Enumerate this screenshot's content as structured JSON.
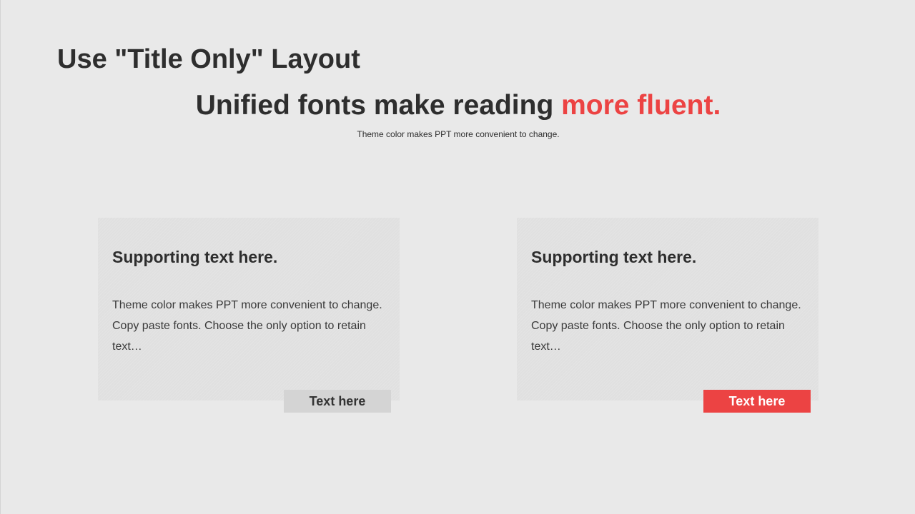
{
  "slide": {
    "layout_title": "Use \"Title Only\" Layout",
    "headline": {
      "main": "Unified fonts make reading ",
      "accent": "more fluent."
    },
    "subline": "Theme color makes PPT more convenient to change."
  },
  "cards": [
    {
      "heading": "Supporting text here.",
      "body": "Theme color makes PPT more convenient to change. Copy paste fonts. Choose the only option to retain text…",
      "button_label": "Text here"
    },
    {
      "heading": "Supporting text here.",
      "body": "Theme color makes PPT more convenient to change. Copy paste fonts. Choose the only option to retain text…",
      "button_label": "Text here"
    }
  ],
  "colors": {
    "background": "#e9e9e9",
    "text": "#2e2e2e",
    "accent": "#ec4343",
    "card": "#e0e0e0",
    "muted_button": "#d4d4d4"
  }
}
